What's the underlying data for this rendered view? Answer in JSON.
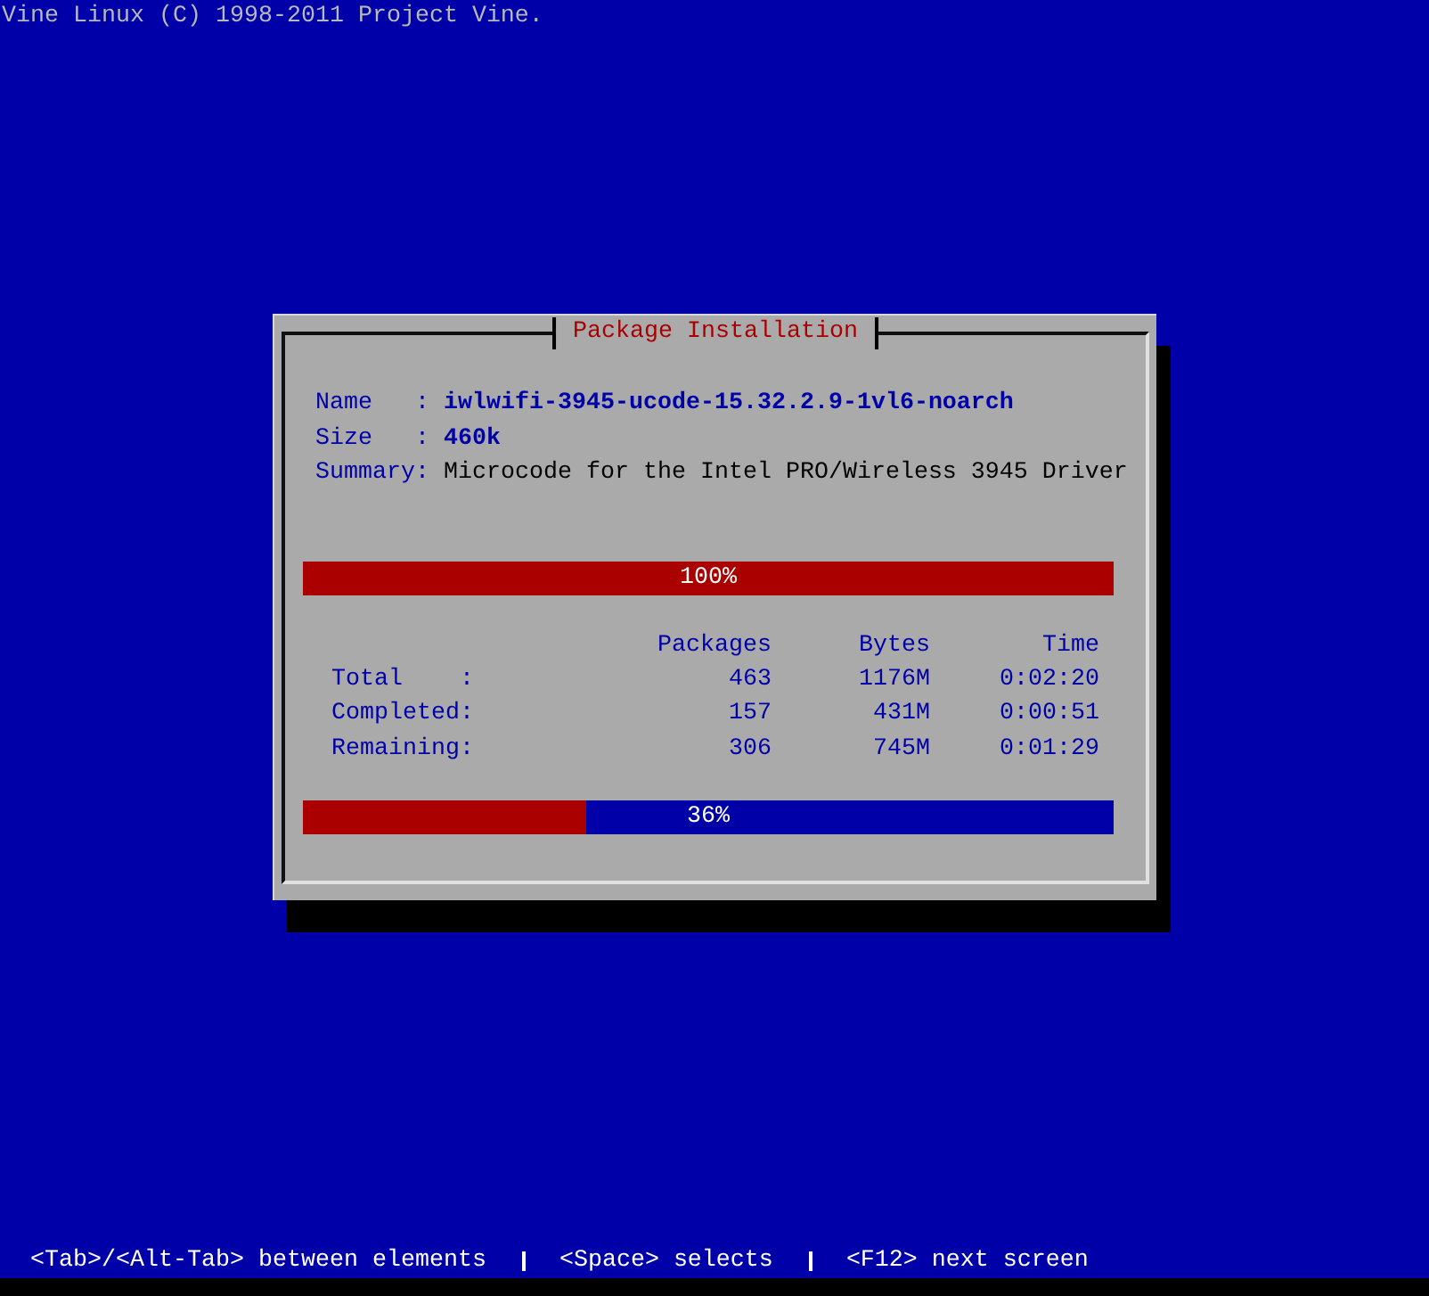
{
  "header": "Vine Linux (C) 1998-2011 Project Vine.",
  "dialog": {
    "title": "Package Installation",
    "fields": [
      {
        "label": "Name   :",
        "value": "iwlwifi-3945-ucode-15.32.2.9-1vl6-noarch",
        "kind": "highlight"
      },
      {
        "label": "Size   :",
        "value": "460k",
        "kind": "highlight"
      },
      {
        "label": "Summary:",
        "value": "Microcode for the Intel PRO/Wireless 3945 Driver",
        "kind": "plain"
      }
    ],
    "package_progress": {
      "level": 1.0,
      "label": "100%"
    },
    "table": {
      "columns": [
        "Packages",
        "Bytes",
        "Time"
      ],
      "rows": [
        {
          "label": "Total    :",
          "cells": [
            "463",
            "1176M",
            "0:02:20"
          ]
        },
        {
          "label": "Completed:",
          "cells": [
            "157",
            "431M",
            "0:00:51"
          ]
        },
        {
          "label": "Remaining:",
          "cells": [
            "306",
            "745M",
            "0:01:29"
          ]
        }
      ]
    },
    "total_progress": {
      "level": 0.35,
      "label": "36%"
    }
  },
  "status_bar": [
    "<Tab>/<Alt-Tab> between elements",
    "<Space> selects",
    "<F12> next screen"
  ]
}
